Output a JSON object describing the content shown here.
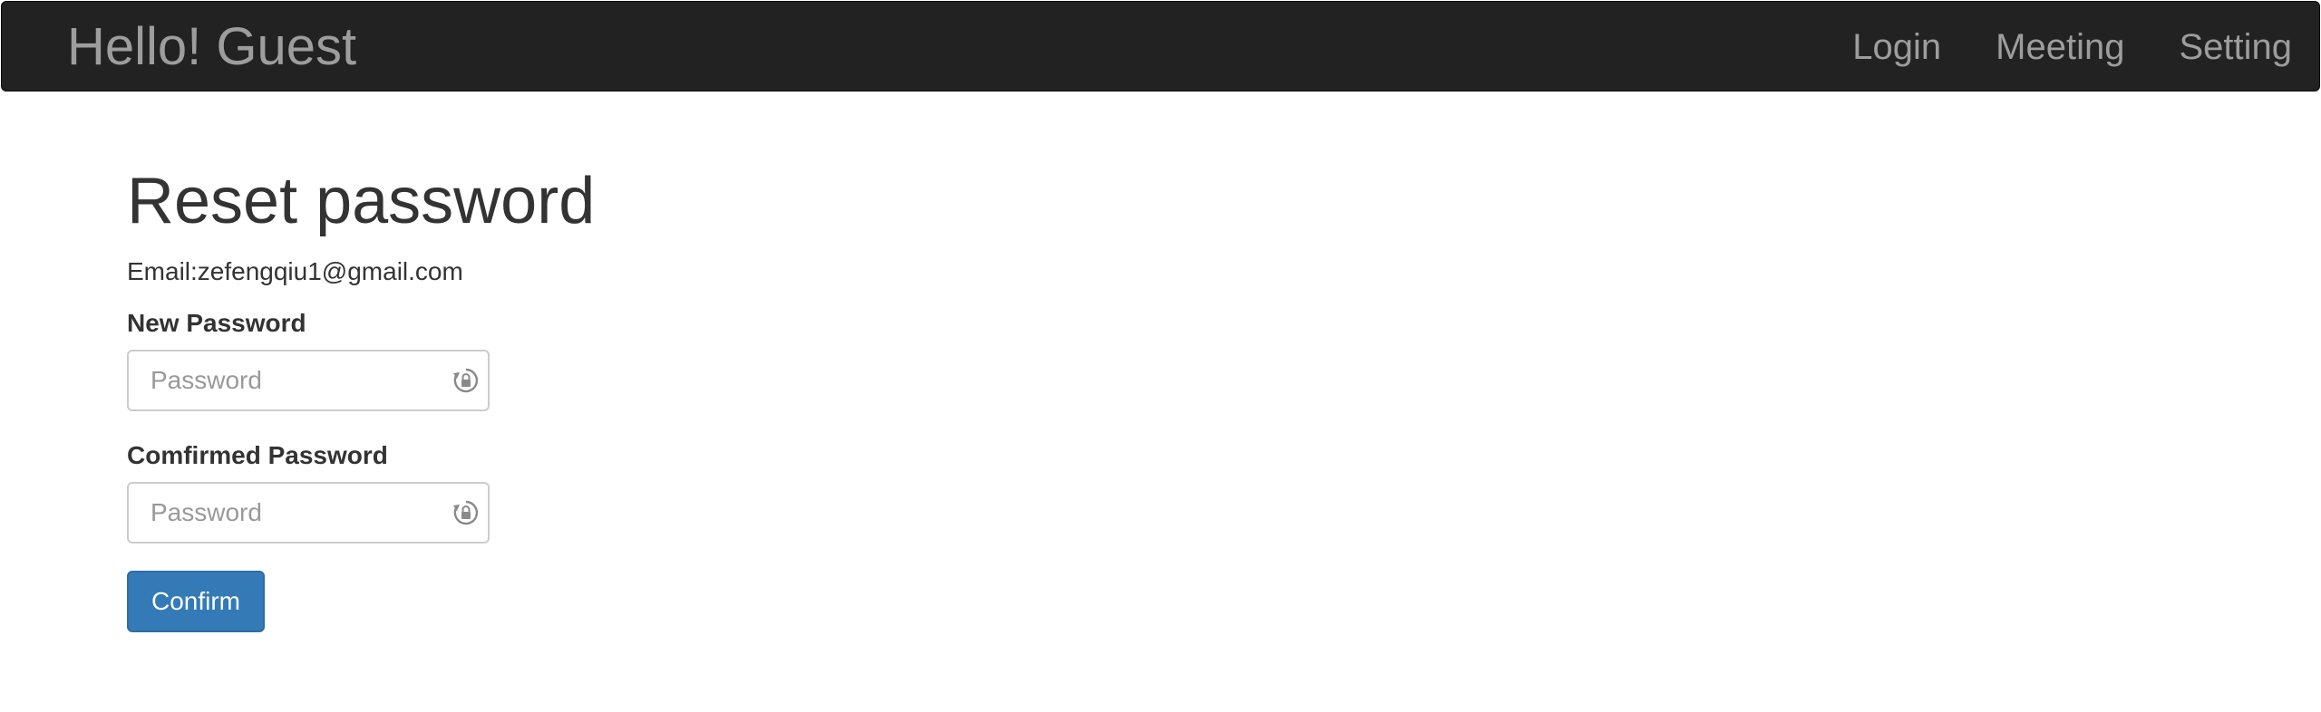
{
  "navbar": {
    "brand": "Hello! Guest",
    "links": [
      {
        "label": "Login"
      },
      {
        "label": "Meeting"
      },
      {
        "label": "Setting"
      }
    ]
  },
  "main": {
    "title": "Reset password",
    "email_text": "Email:zefengqiu1@gmail.com",
    "new_password": {
      "label": "New Password",
      "placeholder": "Password",
      "value": "",
      "icon": "lock-reset-icon"
    },
    "confirm_password": {
      "label": "Comfirmed Password",
      "placeholder": "Password",
      "value": "",
      "icon": "lock-reset-icon"
    },
    "confirm_button": "Confirm"
  },
  "colors": {
    "navbar_bg": "#222222",
    "nav_text": "#9d9d9d",
    "primary": "#337ab7",
    "text": "#333333"
  }
}
